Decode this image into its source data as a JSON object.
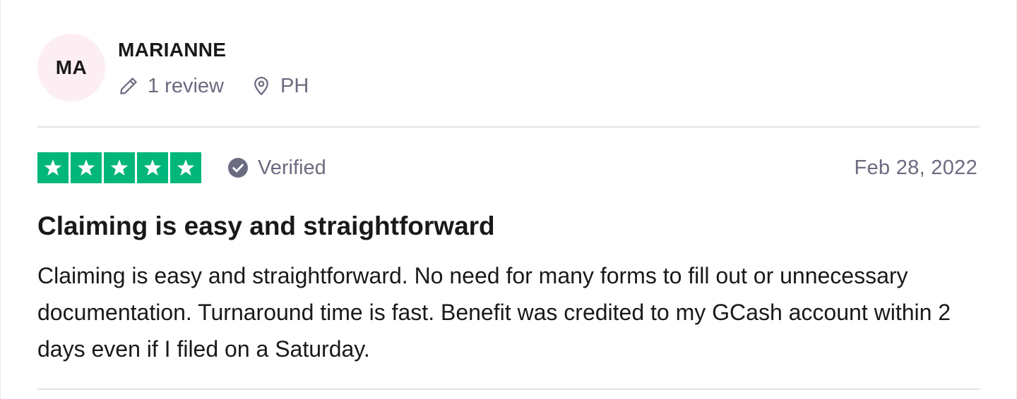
{
  "consumer": {
    "initials": "MA",
    "name": "MARIANNE",
    "reviews_label": "1 review",
    "location": "PH",
    "avatar_color": "#fdeef3"
  },
  "review": {
    "rating": 5,
    "rating_max": 5,
    "star_color": "#00b67a",
    "verified_label": "Verified",
    "date": "Feb 28, 2022",
    "title": "Claiming is easy and straightforward",
    "body": "Claiming is easy and straightforward. No need for many forms to fill out or unnecessary documentation. Turnaround time is fast. Benefit was credited to my GCash account within 2 days even if I filed on a Saturday."
  },
  "icons": {
    "reviews": "pencil-icon",
    "location": "location-pin-icon",
    "verified": "verified-check-icon",
    "star": "star-icon"
  }
}
